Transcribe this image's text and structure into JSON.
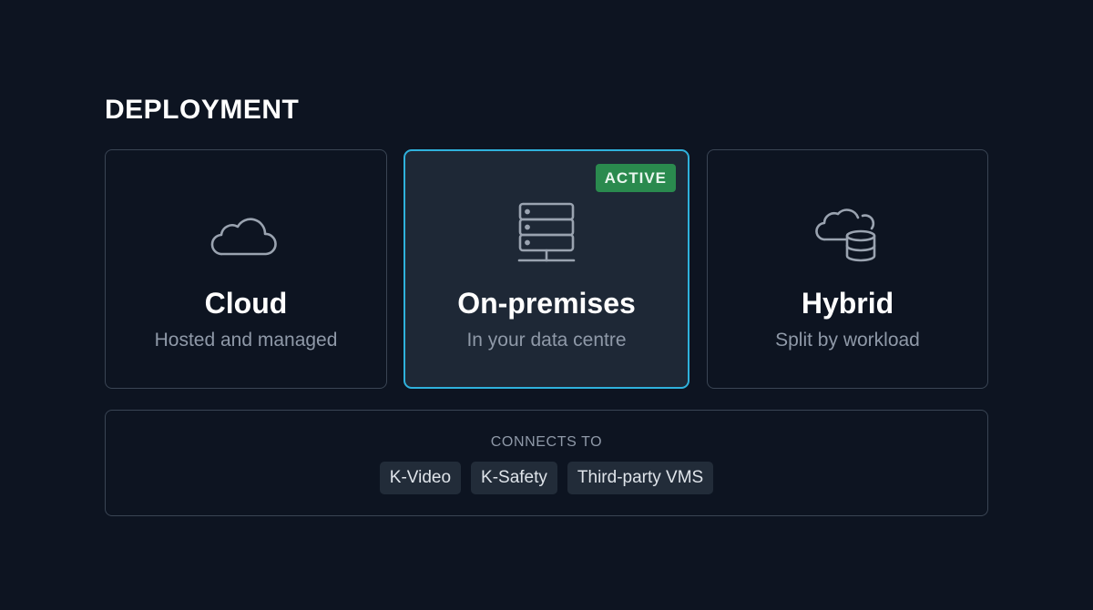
{
  "section": {
    "title": "DEPLOYMENT"
  },
  "options": [
    {
      "id": "cloud",
      "title": "Cloud",
      "subtitle": "Hosted and managed",
      "icon": "cloud-icon",
      "active": false
    },
    {
      "id": "on-premises",
      "title": "On-premises",
      "subtitle": "In your data centre",
      "icon": "server-icon",
      "active": true,
      "badge": "ACTIVE"
    },
    {
      "id": "hybrid",
      "title": "Hybrid",
      "subtitle": "Split by workload",
      "icon": "cloud-database-icon",
      "active": false
    }
  ],
  "connects": {
    "label": "CONNECTS TO",
    "items": [
      "K-Video",
      "K-Safety",
      "Third-party VMS"
    ]
  },
  "colors": {
    "background": "#0d1421",
    "active_border": "#2fb1dc",
    "active_card_bg": "#1e2836",
    "badge_bg": "#2a8a4e",
    "card_border": "#3a4554",
    "muted_text": "#8f99a8",
    "icon_stroke": "#9aa3b0"
  }
}
